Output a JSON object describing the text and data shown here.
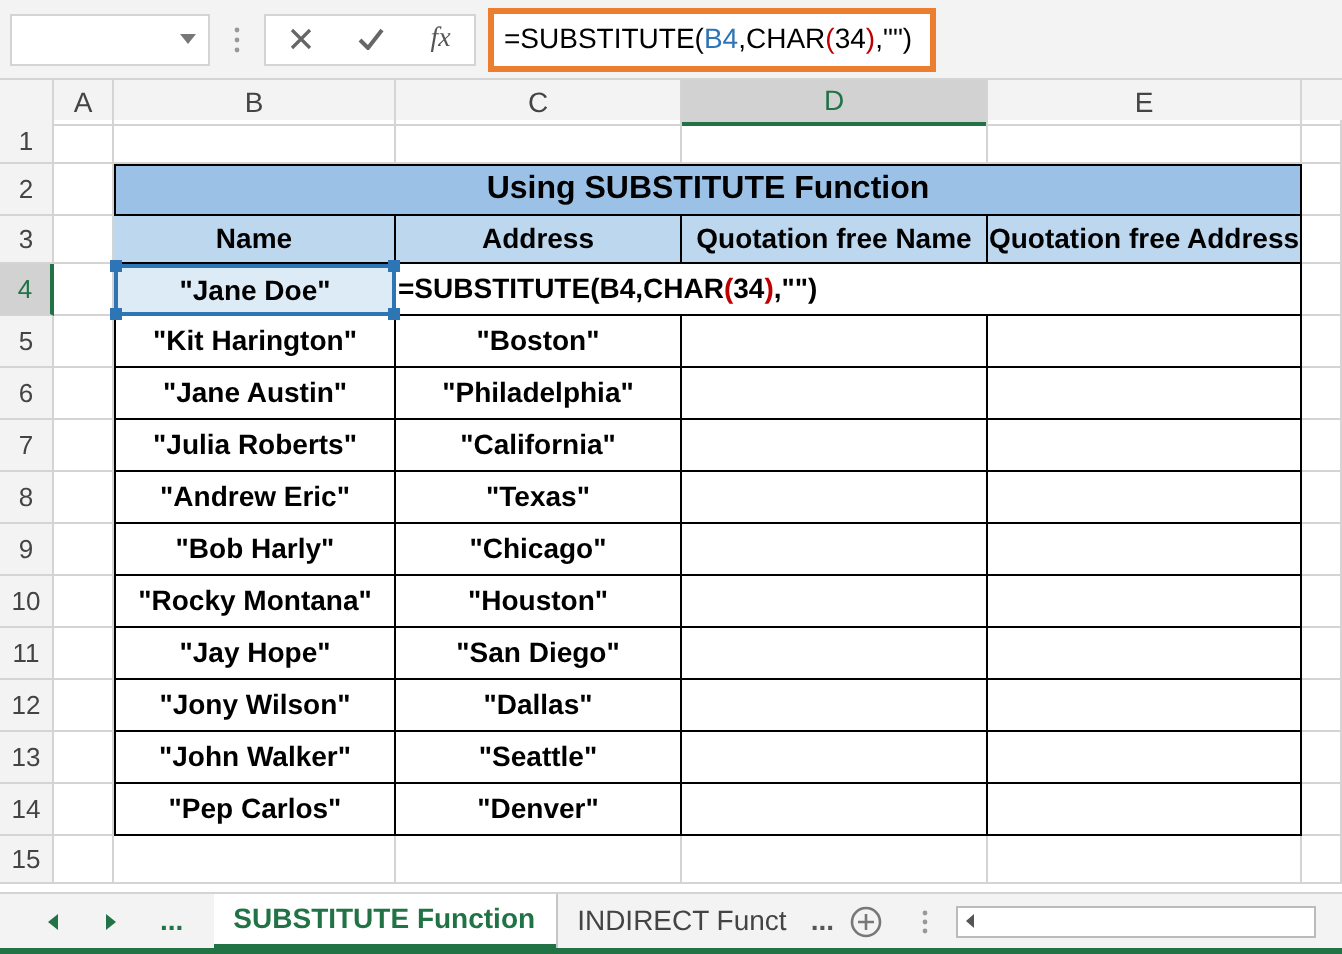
{
  "formula_bar": {
    "fx": "fx",
    "segments": [
      {
        "text": "=SUBSTITUTE(",
        "color": "#000000"
      },
      {
        "text": "B4",
        "color": "#2e75b6"
      },
      {
        "text": ",CHAR",
        "color": "#000000"
      },
      {
        "text": "(",
        "color": "#c00000"
      },
      {
        "text": "34",
        "color": "#000000"
      },
      {
        "text": ")",
        "color": "#c00000"
      },
      {
        "text": ",\"\")",
        "color": "#000000"
      }
    ]
  },
  "columns": [
    {
      "label": "A",
      "selected": false
    },
    {
      "label": "B",
      "selected": false
    },
    {
      "label": "C",
      "selected": false
    },
    {
      "label": "D",
      "selected": true
    },
    {
      "label": "E",
      "selected": false
    }
  ],
  "row_numbers": [
    {
      "label": "1",
      "selected": false
    },
    {
      "label": "2",
      "selected": false
    },
    {
      "label": "3",
      "selected": false
    },
    {
      "label": "4",
      "selected": true
    },
    {
      "label": "5",
      "selected": false
    },
    {
      "label": "6",
      "selected": false
    },
    {
      "label": "7",
      "selected": false
    },
    {
      "label": "8",
      "selected": false
    },
    {
      "label": "9",
      "selected": false
    },
    {
      "label": "10",
      "selected": false
    },
    {
      "label": "11",
      "selected": false
    },
    {
      "label": "12",
      "selected": false
    },
    {
      "label": "13",
      "selected": false
    },
    {
      "label": "14",
      "selected": false
    },
    {
      "label": "15",
      "selected": false
    }
  ],
  "table": {
    "title": "Using SUBSTITUTE Function",
    "headers": [
      "Name",
      "Address",
      "Quotation free Name",
      "Quotation free Address"
    ],
    "editing_row": {
      "name": "\"Jane Doe\"",
      "selected": true,
      "segments": [
        {
          "text": "=SUBSTITUTE(B4,CHAR",
          "color": "#000000"
        },
        {
          "text": "(",
          "color": "#c00000"
        },
        {
          "text": "34",
          "color": "#000000"
        },
        {
          "text": ")",
          "color": "#c00000"
        },
        {
          "text": ",\"\")",
          "color": "#000000"
        }
      ]
    },
    "rows": [
      {
        "name": "\"Kit Harington\"",
        "address": "\"Boston\""
      },
      {
        "name": "\"Jane Austin\"",
        "address": "\"Philadelphia\""
      },
      {
        "name": "\"Julia Roberts\"",
        "address": "\"California\""
      },
      {
        "name": "\"Andrew Eric\"",
        "address": "\"Texas\""
      },
      {
        "name": "\"Bob Harly\"",
        "address": "\"Chicago\""
      },
      {
        "name": "\"Rocky Montana\"",
        "address": "\"Houston\""
      },
      {
        "name": "\"Jay Hope\"",
        "address": "\"San Diego\""
      },
      {
        "name": "\"Jony Wilson\"",
        "address": "\"Dallas\""
      },
      {
        "name": "\"John Walker\"",
        "address": "\"Seattle\""
      },
      {
        "name": "\"Pep Carlos\"",
        "address": "\"Denver\""
      }
    ]
  },
  "sheet_tabs": {
    "more_left": "...",
    "tabs": [
      {
        "label": "SUBSTITUTE Function",
        "selected": true
      },
      {
        "label": "INDIRECT Funct",
        "selected": false
      }
    ],
    "more_right": "..."
  }
}
